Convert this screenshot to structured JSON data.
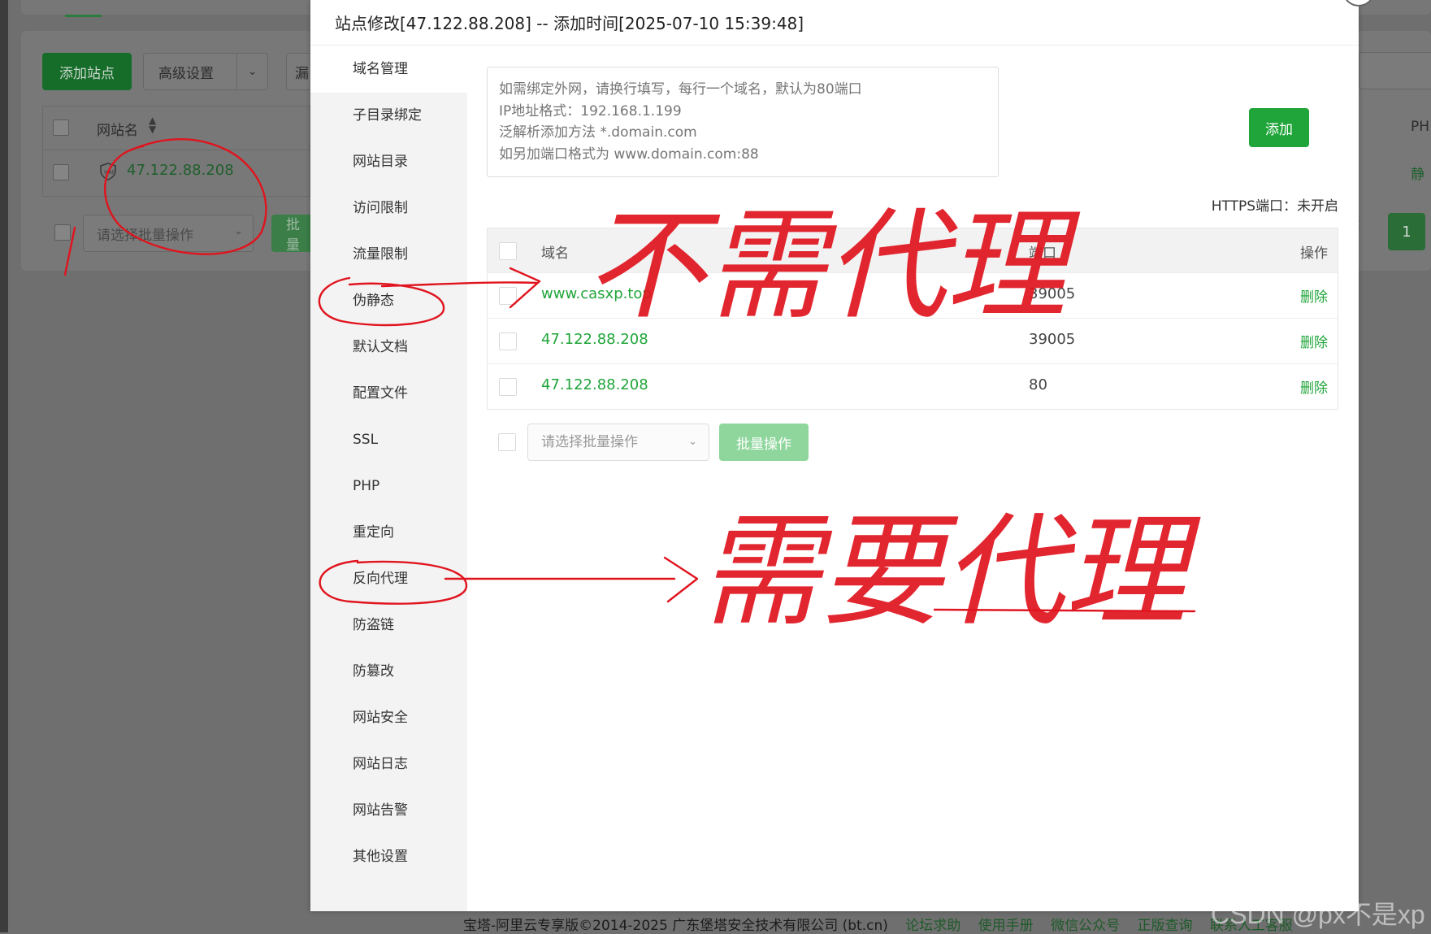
{
  "modal": {
    "title": "站点修改[47.122.88.208] -- 添加时间[2025-07-10 15:39:48]"
  },
  "sidebar": {
    "items": [
      {
        "label": "域名管理",
        "active": true
      },
      {
        "label": "子目录绑定"
      },
      {
        "label": "网站目录"
      },
      {
        "label": "访问限制"
      },
      {
        "label": "流量限制"
      },
      {
        "label": "伪静态"
      },
      {
        "label": "默认文档"
      },
      {
        "label": "配置文件"
      },
      {
        "label": "SSL"
      },
      {
        "label": "PHP"
      },
      {
        "label": "重定向"
      },
      {
        "label": "反向代理"
      },
      {
        "label": "防盗链"
      },
      {
        "label": "防篡改"
      },
      {
        "label": "网站安全"
      },
      {
        "label": "网站日志"
      },
      {
        "label": "网站告警"
      },
      {
        "label": "其他设置"
      }
    ]
  },
  "domain_form": {
    "placeholder": "如需绑定外网，请换行填写，每行一个域名，默认为80端口\nIP地址格式：192.168.1.199\n泛解析添加方法 *.domain.com\n如另加端口格式为 www.domain.com:88",
    "add_label": "添加",
    "https_status": "HTTPS端口：未开启"
  },
  "domain_table": {
    "headers": {
      "domain": "域名",
      "port": "端口",
      "op": "操作"
    },
    "rows": [
      {
        "domain": "www.casxp.top",
        "port": "39005",
        "op": "删除"
      },
      {
        "domain": "47.122.88.208",
        "port": "39005",
        "op": "删除"
      },
      {
        "domain": "47.122.88.208",
        "port": "80",
        "op": "删除"
      }
    ]
  },
  "batch": {
    "select_placeholder": "请选择批量操作",
    "button_label": "批量操作"
  },
  "background": {
    "add_site": "添加站点",
    "advanced": "高级设置",
    "leak": "漏",
    "site_name_header": "网站名",
    "site": "47.122.88.208",
    "batch_select": "请选择批量操作",
    "batch_btn": "批量",
    "right_input": "",
    "php_header": "PH",
    "static_label": "静",
    "page_prev": "<",
    "page_current": "1",
    "footer_text": "宝塔-阿里云专享版©2014-2025 广东堡塔安全技术有限公司 (bt.cn)",
    "footer_links": [
      "论坛求助",
      "使用手册",
      "微信公众号",
      "正版查询",
      "联系人工客服"
    ]
  },
  "annotations": {
    "no_proxy": "不需代理",
    "need_proxy": "需要代理",
    "ink_color": "#e0141e"
  },
  "watermark": "CSDN @px不是xp",
  "colors": {
    "accent": "#20a53a",
    "accent_light": "#8fd69d"
  }
}
